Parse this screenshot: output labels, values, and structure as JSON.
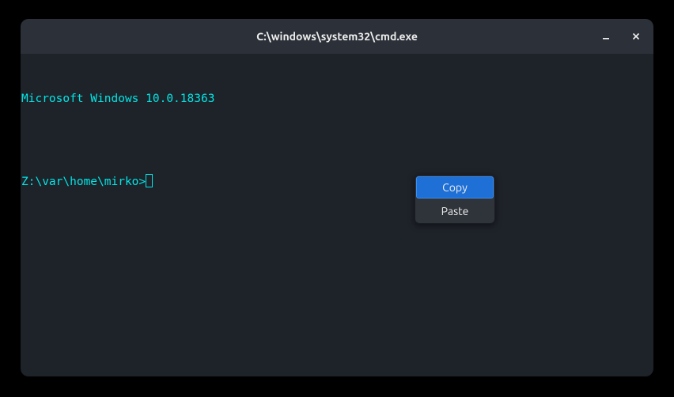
{
  "window": {
    "title": "C:\\windows\\system32\\cmd.exe"
  },
  "terminal": {
    "line1": "Microsoft Windows 10.0.18363",
    "blank": "",
    "prompt": "Z:\\var\\home\\mirko>"
  },
  "context_menu": {
    "items": [
      {
        "label": "Copy"
      },
      {
        "label": "Paste"
      }
    ]
  }
}
